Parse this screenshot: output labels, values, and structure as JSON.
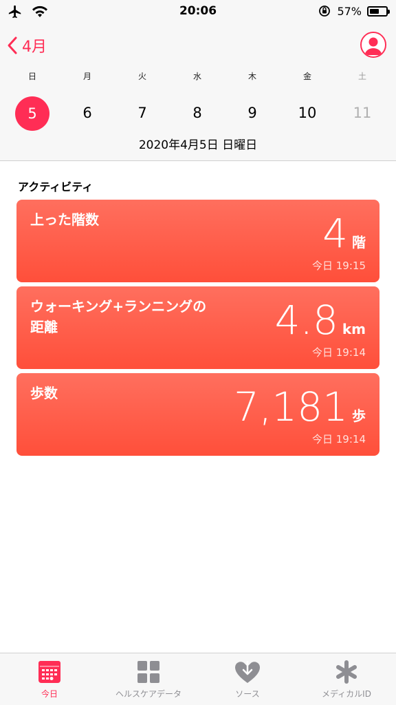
{
  "status_bar": {
    "time": "20:06",
    "battery_text": "57%",
    "battery_level": 0.57
  },
  "header": {
    "back_label": "4月",
    "weekdays": [
      "日",
      "月",
      "火",
      "水",
      "木",
      "金",
      "土"
    ],
    "days": [
      "5",
      "6",
      "7",
      "8",
      "9",
      "10",
      "11"
    ],
    "selected_index": 0,
    "date_label": "2020年4月5日 日曜日"
  },
  "section": {
    "title": "アクティビティ"
  },
  "cards": [
    {
      "title": "上った階数",
      "value": "4",
      "unit": "階",
      "time": "今日 19:15"
    },
    {
      "title": "ウォーキング+ランニングの\n距離",
      "value": "4.8",
      "unit": "km",
      "time": "今日 19:14"
    },
    {
      "title": "歩数",
      "value": "7,181",
      "unit": "歩",
      "time": "今日 19:14"
    }
  ],
  "tabs": [
    {
      "label": "今日",
      "icon": "calendar-icon",
      "active": true
    },
    {
      "label": "ヘルスケアデータ",
      "icon": "grid-icon",
      "active": false
    },
    {
      "label": "ソース",
      "icon": "heart-download-icon",
      "active": false
    },
    {
      "label": "メディカルID",
      "icon": "asterisk-icon",
      "active": false
    }
  ],
  "colors": {
    "accent": "#ff2d55",
    "card_gradient_top": "#ff6f5e",
    "card_gradient_bottom": "#ff4f3a",
    "tab_inactive": "#8e8e93"
  }
}
